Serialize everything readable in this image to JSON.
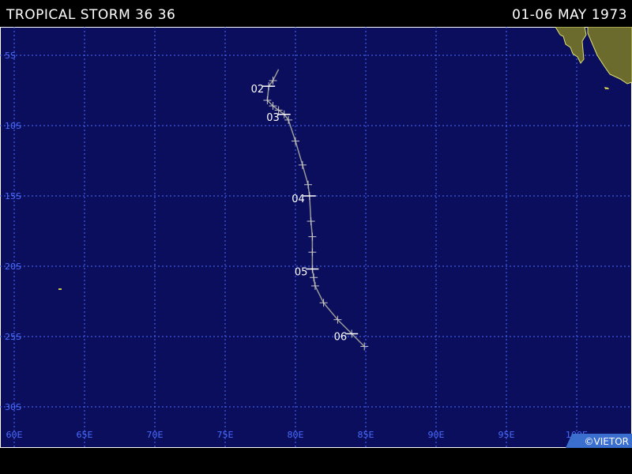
{
  "header": {
    "title": "TROPICAL STORM 36 36",
    "dates": "01-06 MAY 1973"
  },
  "map": {
    "ocean_color": "#0a0e5c",
    "land_color": "#6b6b2e",
    "grid_color": "#4a6cff",
    "track_color": "#9a9a9a",
    "lat_labels": [
      "5S",
      "10S",
      "15S",
      "20S",
      "25S",
      "30S"
    ],
    "lon_labels": [
      "60E",
      "65E",
      "70E",
      "75E",
      "80E",
      "85E",
      "90E",
      "95E",
      "100E"
    ],
    "credit": "©VIETOR"
  },
  "track": {
    "points": [
      {
        "lon": 78.8,
        "lat": -6.0
      },
      {
        "lon": 78.4,
        "lat": -6.8
      },
      {
        "lon": 78.1,
        "lat": -7.2
      },
      {
        "lon": 78.0,
        "lat": -8.2
      },
      {
        "lon": 78.4,
        "lat": -8.6
      },
      {
        "lon": 78.8,
        "lat": -8.9
      },
      {
        "lon": 79.2,
        "lat": -9.2
      },
      {
        "lon": 79.5,
        "lat": -9.6
      },
      {
        "lon": 80.0,
        "lat": -11.1
      },
      {
        "lon": 80.5,
        "lat": -12.8
      },
      {
        "lon": 80.9,
        "lat": -14.2
      },
      {
        "lon": 81.0,
        "lat": -15.0
      },
      {
        "lon": 81.1,
        "lat": -16.8
      },
      {
        "lon": 81.2,
        "lat": -17.9
      },
      {
        "lon": 81.2,
        "lat": -19.0
      },
      {
        "lon": 81.2,
        "lat": -20.2
      },
      {
        "lon": 81.3,
        "lat": -20.8
      },
      {
        "lon": 81.4,
        "lat": -21.4
      },
      {
        "lon": 82.0,
        "lat": -22.6
      },
      {
        "lon": 83.0,
        "lat": -23.8
      },
      {
        "lon": 84.0,
        "lat": -24.8
      },
      {
        "lon": 84.9,
        "lat": -25.7
      }
    ],
    "day_labels": [
      {
        "label": "02",
        "lon": 78.1,
        "lat": -7.2,
        "at": 2
      },
      {
        "label": "03",
        "lon": 79.2,
        "lat": -9.2,
        "at": 6
      },
      {
        "label": "04",
        "lon": 81.0,
        "lat": -15.0,
        "at": 11
      },
      {
        "label": "05",
        "lon": 81.2,
        "lat": -20.2,
        "at": 15
      },
      {
        "label": "06",
        "lon": 84.0,
        "lat": -24.8,
        "at": 20
      }
    ]
  }
}
